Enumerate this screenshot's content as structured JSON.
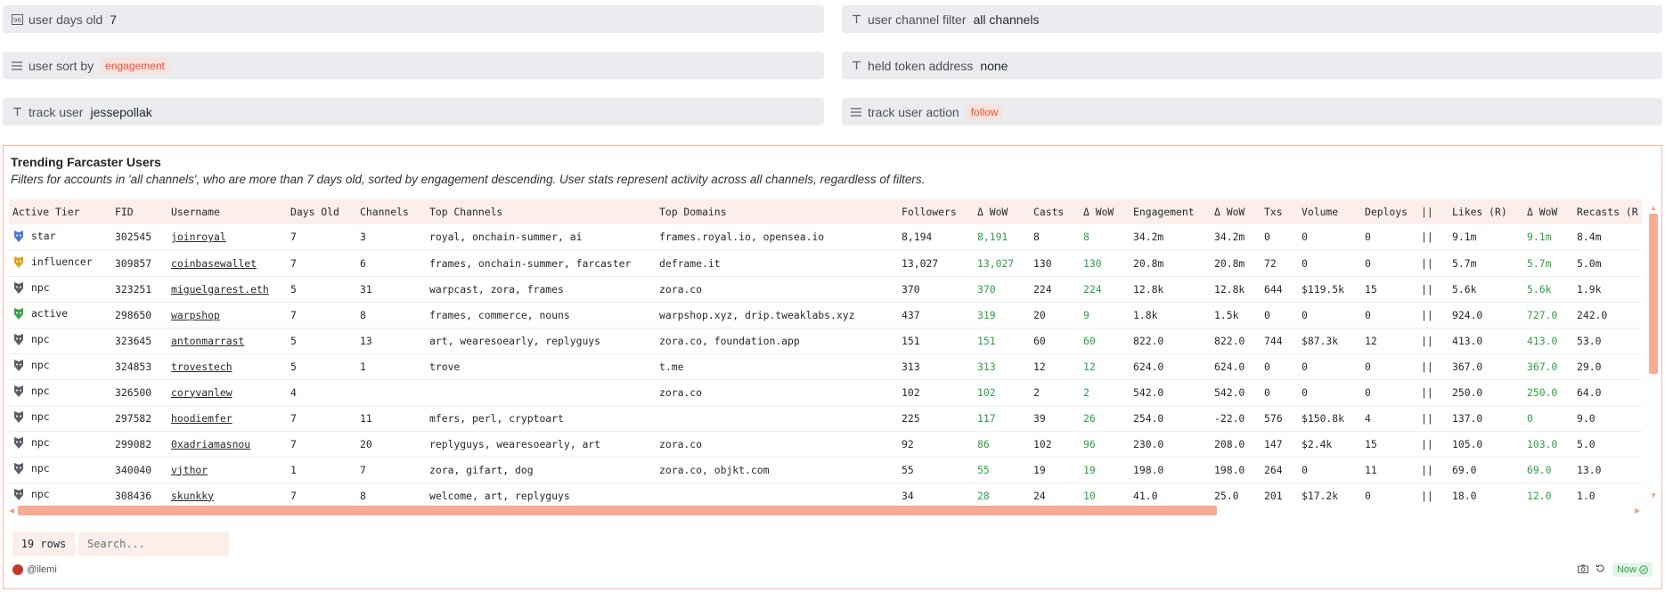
{
  "params": {
    "user_days_old": {
      "label": "user days old",
      "value": "7"
    },
    "user_channel_filter": {
      "label": "user channel filter",
      "value": "all channels"
    },
    "user_sort_by": {
      "label": "user sort by",
      "value": "engagement"
    },
    "held_token_address": {
      "label": "held token address",
      "value": "none"
    },
    "track_user": {
      "label": "track user",
      "value": "jessepollak"
    },
    "track_user_action": {
      "label": "track user action",
      "value": "follow"
    }
  },
  "card": {
    "title": "Trending Farcaster Users",
    "description": "Filters for accounts in 'all channels', who are more than 7 days old, sorted by engagement descending. User stats represent activity across all channels, regardless of filters."
  },
  "table": {
    "headers": [
      "Active Tier",
      "FID",
      "Username",
      "Days Old",
      "Channels",
      "Top Channels",
      "Top Domains",
      "Followers",
      "Δ WoW",
      "Casts",
      "Δ WoW",
      "Engagement",
      "Δ WoW",
      "Txs",
      "Volume",
      "Deploys",
      "||",
      "Likes (R)",
      "Δ WoW",
      "Recasts (R"
    ],
    "rows": [
      {
        "tier": "star",
        "badge": "#4a7bd0",
        "fid": "302545",
        "username": "joinroyal",
        "days": "7",
        "channels": "3",
        "top_channels": "royal, onchain-summer, ai",
        "top_domains": "frames.royal.io, opensea.io",
        "followers": "8,194",
        "followers_wow": "8,191",
        "casts": "8",
        "casts_wow": "8",
        "engagement": "34.2m",
        "engagement_wow": "34.2m",
        "txs": "0",
        "volume": "0",
        "deploys": "0",
        "sep": "||",
        "likes": "9.1m",
        "likes_wow": "9.1m",
        "recasts": "8.4m"
      },
      {
        "tier": "influencer",
        "badge": "#e0a020",
        "fid": "309857",
        "username": "coinbasewallet",
        "days": "7",
        "channels": "6",
        "top_channels": "frames, onchain-summer, farcaster",
        "top_domains": "deframe.it",
        "followers": "13,027",
        "followers_wow": "13,027",
        "casts": "130",
        "casts_wow": "130",
        "engagement": "20.8m",
        "engagement_wow": "20.8m",
        "txs": "72",
        "volume": "0",
        "deploys": "0",
        "sep": "||",
        "likes": "5.7m",
        "likes_wow": "5.7m",
        "recasts": "5.0m"
      },
      {
        "tier": "npc",
        "badge": "#5a5e66",
        "fid": "323251",
        "username": "miguelgarest.eth",
        "days": "5",
        "channels": "31",
        "top_channels": "warpcast, zora, frames",
        "top_domains": "zora.co",
        "followers": "370",
        "followers_wow": "370",
        "casts": "224",
        "casts_wow": "224",
        "engagement": "12.8k",
        "engagement_wow": "12.8k",
        "txs": "644",
        "volume": "$119.5k",
        "deploys": "15",
        "sep": "||",
        "likes": "5.6k",
        "likes_wow": "5.6k",
        "recasts": "1.9k"
      },
      {
        "tier": "active",
        "badge": "#3aa04a",
        "fid": "298650",
        "username": "warpshop",
        "days": "7",
        "channels": "8",
        "top_channels": "frames, commerce, nouns",
        "top_domains": "warpshop.xyz, drip.tweaklabs.xyz",
        "followers": "437",
        "followers_wow": "319",
        "casts": "20",
        "casts_wow": "9",
        "engagement": "1.8k",
        "engagement_wow": "1.5k",
        "txs": "0",
        "volume": "0",
        "deploys": "0",
        "sep": "||",
        "likes": "924.0",
        "likes_wow": "727.0",
        "recasts": "242.0"
      },
      {
        "tier": "npc",
        "badge": "#5a5e66",
        "fid": "323645",
        "username": "antonmarrast",
        "days": "5",
        "channels": "13",
        "top_channels": "art, wearesoearly, replyguys",
        "top_domains": "zora.co, foundation.app",
        "followers": "151",
        "followers_wow": "151",
        "casts": "60",
        "casts_wow": "60",
        "engagement": "822.0",
        "engagement_wow": "822.0",
        "txs": "744",
        "volume": "$87.3k",
        "deploys": "12",
        "sep": "||",
        "likes": "413.0",
        "likes_wow": "413.0",
        "recasts": "53.0"
      },
      {
        "tier": "npc",
        "badge": "#5a5e66",
        "fid": "324853",
        "username": "trovestech",
        "days": "5",
        "channels": "1",
        "top_channels": "trove",
        "top_domains": "t.me",
        "followers": "313",
        "followers_wow": "313",
        "casts": "12",
        "casts_wow": "12",
        "engagement": "624.0",
        "engagement_wow": "624.0",
        "txs": "0",
        "volume": "0",
        "deploys": "0",
        "sep": "||",
        "likes": "367.0",
        "likes_wow": "367.0",
        "recasts": "29.0"
      },
      {
        "tier": "npc",
        "badge": "#5a5e66",
        "fid": "326500",
        "username": "coryvanlew",
        "days": "4",
        "channels": "",
        "top_channels": "",
        "top_domains": "zora.co",
        "followers": "102",
        "followers_wow": "102",
        "casts": "2",
        "casts_wow": "2",
        "engagement": "542.0",
        "engagement_wow": "542.0",
        "txs": "0",
        "volume": "0",
        "deploys": "0",
        "sep": "||",
        "likes": "250.0",
        "likes_wow": "250.0",
        "recasts": "64.0"
      },
      {
        "tier": "npc",
        "badge": "#5a5e66",
        "fid": "297582",
        "username": "hoodiemfer",
        "days": "7",
        "channels": "11",
        "top_channels": "mfers, perl, cryptoart",
        "top_domains": "",
        "followers": "225",
        "followers_wow": "117",
        "casts": "39",
        "casts_wow": "26",
        "engagement": "254.0",
        "engagement_wow": "-22.0",
        "txs": "576",
        "volume": "$150.8k",
        "deploys": "4",
        "sep": "||",
        "likes": "137.0",
        "likes_wow": "0",
        "recasts": "9.0"
      },
      {
        "tier": "npc",
        "badge": "#5a5e66",
        "fid": "299082",
        "username": "0xadriamasnou",
        "days": "7",
        "channels": "20",
        "top_channels": "replyguys, wearesoearly, art",
        "top_domains": "zora.co",
        "followers": "92",
        "followers_wow": "86",
        "casts": "102",
        "casts_wow": "96",
        "engagement": "230.0",
        "engagement_wow": "208.0",
        "txs": "147",
        "volume": "$2.4k",
        "deploys": "15",
        "sep": "||",
        "likes": "105.0",
        "likes_wow": "103.0",
        "recasts": "5.0"
      },
      {
        "tier": "npc",
        "badge": "#5a5e66",
        "fid": "340040",
        "username": "vjthor",
        "days": "1",
        "channels": "7",
        "top_channels": "zora, gifart, dog",
        "top_domains": "zora.co, objkt.com",
        "followers": "55",
        "followers_wow": "55",
        "casts": "19",
        "casts_wow": "19",
        "engagement": "198.0",
        "engagement_wow": "198.0",
        "txs": "264",
        "volume": "0",
        "deploys": "11",
        "sep": "||",
        "likes": "69.0",
        "likes_wow": "69.0",
        "recasts": "13.0"
      },
      {
        "tier": "npc",
        "badge": "#5a5e66",
        "fid": "308436",
        "username": "skunkky",
        "days": "7",
        "channels": "8",
        "top_channels": "welcome, art, replyguys",
        "top_domains": "",
        "followers": "34",
        "followers_wow": "28",
        "casts": "24",
        "casts_wow": "10",
        "engagement": "41.0",
        "engagement_wow": "25.0",
        "txs": "201",
        "volume": "$17.2k",
        "deploys": "0",
        "sep": "||",
        "likes": "18.0",
        "likes_wow": "12.0",
        "recasts": "1.0"
      }
    ]
  },
  "footer": {
    "rows_count": "19 rows",
    "search_placeholder": "Search...",
    "author": "@ilemi",
    "now_label": "Now"
  },
  "colors": {
    "accent": "#f6ab96",
    "positive": "#2ea043",
    "header_bg": "#fcefeb"
  }
}
